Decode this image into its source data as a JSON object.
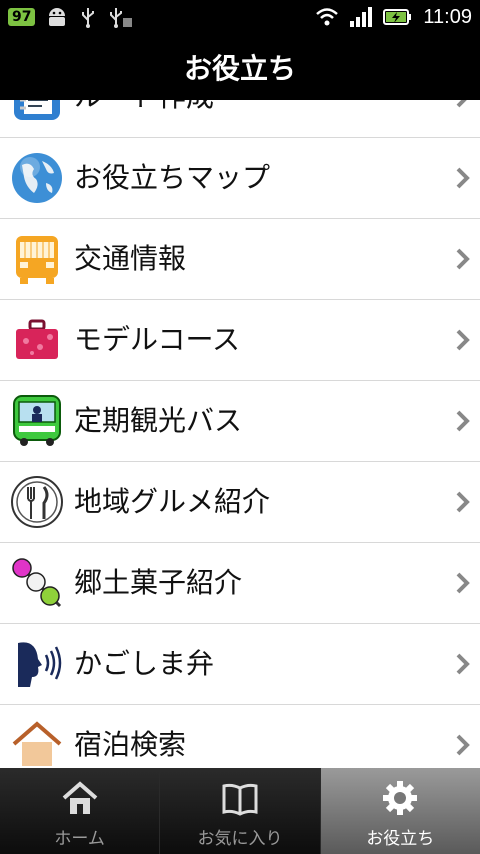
{
  "status": {
    "battery_level": "97",
    "time": "11:09"
  },
  "title": "お役立ち",
  "list": [
    {
      "label": "ルート作成",
      "icon": "route-notebook-icon"
    },
    {
      "label": "お役立ちマップ",
      "icon": "globe-icon"
    },
    {
      "label": "交通情報",
      "icon": "bus-front-icon"
    },
    {
      "label": "モデルコース",
      "icon": "suitcase-icon"
    },
    {
      "label": "定期観光バス",
      "icon": "sightseeing-bus-icon"
    },
    {
      "label": "地域グルメ紹介",
      "icon": "fork-knife-icon"
    },
    {
      "label": "郷土菓子紹介",
      "icon": "dango-icon"
    },
    {
      "label": "かごしま弁",
      "icon": "speaking-head-icon"
    },
    {
      "label": "宿泊検索",
      "icon": "house-icon"
    }
  ],
  "tabs": [
    {
      "label": "ホーム",
      "icon": "home-icon"
    },
    {
      "label": "お気に入り",
      "icon": "book-icon"
    },
    {
      "label": "お役立ち",
      "icon": "gear-icon"
    }
  ]
}
